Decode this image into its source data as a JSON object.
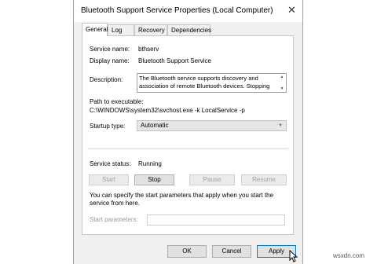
{
  "window": {
    "title": "Bluetooth Support Service Properties (Local Computer)",
    "close_glyph": "✕"
  },
  "tabs": [
    {
      "label": "General",
      "active": true
    },
    {
      "label": "Log On",
      "active": false
    },
    {
      "label": "Recovery",
      "active": false
    },
    {
      "label": "Dependencies",
      "active": false
    }
  ],
  "general": {
    "service_name_label": "Service name:",
    "service_name_value": "bthserv",
    "display_name_label": "Display name:",
    "display_name_value": "Bluetooth Support Service",
    "description_label": "Description:",
    "description_value": "The Bluetooth service supports discovery and association of remote Bluetooth devices.  Stopping",
    "path_label": "Path to executable:",
    "path_value": "C:\\WINDOWS\\system32\\svchost.exe -k LocalService -p",
    "startup_type_label": "Startup type:",
    "startup_type_value": "Automatic",
    "status_label": "Service status:",
    "status_value": "Running",
    "buttons": {
      "start": "Start",
      "stop": "Stop",
      "pause": "Pause",
      "resume": "Resume"
    },
    "hint": "You can specify the start parameters that apply when you start the service from here.",
    "start_params_label": "Start parameters:",
    "start_params_value": ""
  },
  "footer": {
    "ok": "OK",
    "cancel": "Cancel",
    "apply": "Apply"
  },
  "watermark": "wsxdn.com"
}
